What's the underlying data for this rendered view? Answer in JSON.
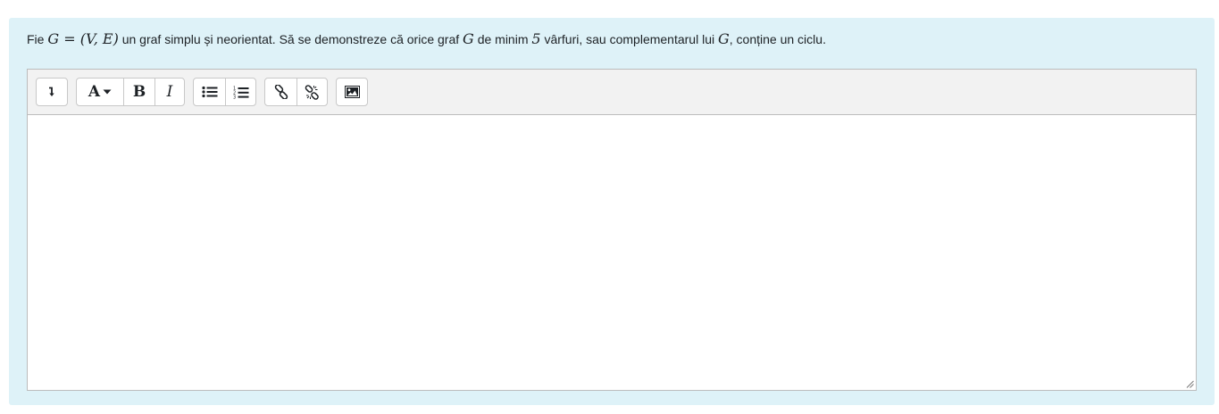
{
  "question": {
    "t1": "Fie ",
    "m1": "G",
    "m1b": " = (",
    "m1c": "V",
    "m1d": ", ",
    "m1e": "E",
    "m1f": ")",
    "t2": " un graf simplu și neorientat. Să se demonstreze că orice graf ",
    "m2": "G",
    "t3": " de minim ",
    "m3": "5",
    "t4": " vârfuri, sau complementarul lui ",
    "m4": "G",
    "t5": ", conține un ciclu."
  },
  "toolbar": {
    "groups": [
      [
        "collapse"
      ],
      [
        "font-style",
        "bold",
        "italic"
      ],
      [
        "bullet-list",
        "numbered-list"
      ],
      [
        "link",
        "unlink"
      ],
      [
        "image"
      ]
    ],
    "bold_label": "B",
    "italic_label": "I",
    "font_label": "A"
  },
  "editor": {
    "content": ""
  },
  "colors": {
    "panel_bg": "#def2f8",
    "toolbar_bg": "#f2f2f2",
    "border": "#bcbcbc",
    "text": "#1d2125"
  }
}
